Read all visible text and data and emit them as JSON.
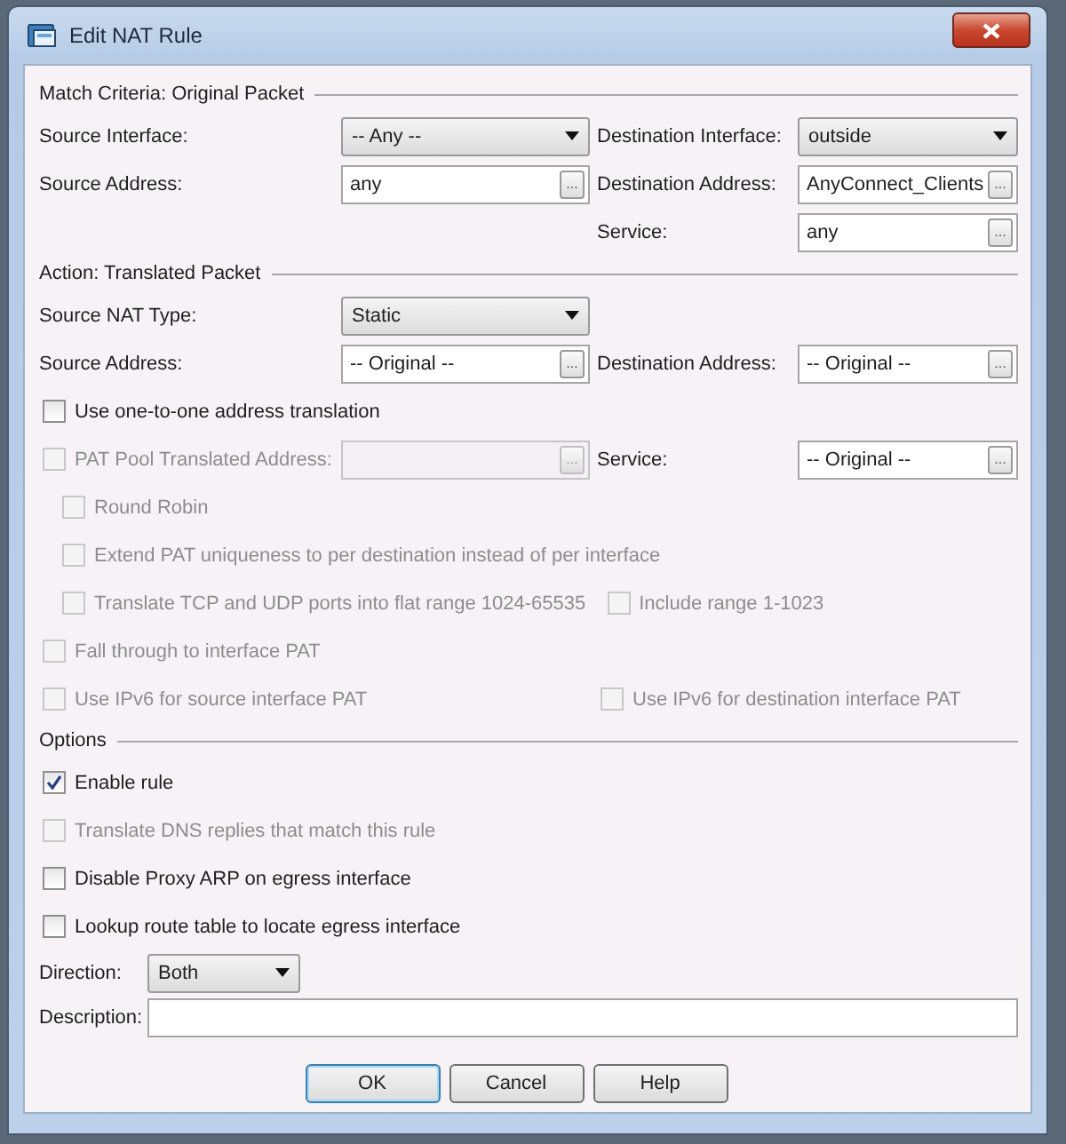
{
  "window": {
    "title": "Edit NAT Rule"
  },
  "sections": [
    {
      "title": "Match Criteria: Original Packet",
      "rows": [
        {
          "kind": "pair",
          "left": [
            {
              "kind": "label",
              "text": "Source Interface:"
            },
            {
              "kind": "dropdown",
              "value": "-- Any --"
            }
          ],
          "right": [
            {
              "kind": "label",
              "text": "Destination Interface:"
            },
            {
              "kind": "dropdown",
              "value": "outside"
            }
          ]
        },
        {
          "kind": "pair",
          "left": [
            {
              "kind": "label",
              "text": "Source Address:"
            },
            {
              "kind": "field",
              "value": "any",
              "button": "..."
            }
          ],
          "right": [
            {
              "kind": "label",
              "text": "Destination Address:"
            },
            {
              "kind": "field",
              "value": "AnyConnect_Clients",
              "button": "..."
            }
          ]
        },
        {
          "kind": "pair",
          "right": [
            {
              "kind": "label",
              "text": "Service:"
            },
            {
              "kind": "field",
              "value": "any",
              "button": "..."
            }
          ]
        }
      ]
    },
    {
      "title": "Action: Translated Packet",
      "rows": [
        {
          "kind": "pair",
          "left": [
            {
              "kind": "label",
              "text": "Source NAT Type:"
            },
            {
              "kind": "dropdown",
              "value": "Static"
            }
          ]
        },
        {
          "kind": "pair",
          "left": [
            {
              "kind": "label",
              "text": "Source Address:"
            },
            {
              "kind": "field",
              "value": "-- Original --",
              "button": "..."
            }
          ],
          "right": [
            {
              "kind": "label",
              "text": "Destination Address:"
            },
            {
              "kind": "field",
              "value": "-- Original --",
              "button": "..."
            }
          ]
        },
        {
          "kind": "pair",
          "left": [
            {
              "kind": "checkbox",
              "label": "Use one-to-one address translation",
              "checked": false,
              "disabled": false
            }
          ]
        },
        {
          "kind": "pair",
          "left": [
            {
              "kind": "checkbox",
              "label": "PAT Pool Translated Address:",
              "checked": false,
              "disabled": true
            },
            {
              "kind": "field",
              "button": "...",
              "disabled": true
            }
          ],
          "right": [
            {
              "kind": "label",
              "text": "Service:"
            },
            {
              "kind": "field",
              "value": "-- Original --",
              "button": "..."
            }
          ],
          "children": [
            {
              "kind": "pair",
              "left": [
                {
                  "kind": "checkbox",
                  "label": "Round Robin",
                  "checked": false,
                  "disabled": true
                }
              ]
            },
            {
              "kind": "pair",
              "left": [
                {
                  "kind": "checkbox",
                  "label": "Extend PAT uniqueness to per destination instead of per interface",
                  "checked": false,
                  "disabled": true
                }
              ]
            },
            {
              "kind": "pair",
              "left": [
                {
                  "kind": "checkbox",
                  "label": "Translate TCP and UDP ports into flat range 1024-65535",
                  "checked": false,
                  "disabled": true
                },
                {
                  "kind": "checkbox",
                  "label": "Include range 1-1023",
                  "checked": false,
                  "disabled": true
                }
              ]
            }
          ]
        },
        {
          "kind": "pair",
          "left": [
            {
              "kind": "checkbox",
              "label": "Fall through to interface PAT",
              "checked": false,
              "disabled": true
            }
          ]
        },
        {
          "kind": "pair",
          "left": [
            {
              "kind": "checkbox",
              "label": "Use IPv6 for source interface PAT",
              "checked": false,
              "disabled": true
            }
          ],
          "right": [
            {
              "kind": "checkbox",
              "label": "Use IPv6 for destination interface PAT",
              "checked": false,
              "disabled": true
            }
          ]
        }
      ]
    },
    {
      "title": "Options",
      "rows": [
        {
          "kind": "pair",
          "left": [
            {
              "kind": "checkbox",
              "label": "Enable rule",
              "checked": true,
              "disabled": false
            }
          ]
        },
        {
          "kind": "pair",
          "left": [
            {
              "kind": "checkbox",
              "label": "Translate DNS replies that match this rule",
              "checked": false,
              "disabled": true
            }
          ]
        },
        {
          "kind": "pair",
          "left": [
            {
              "kind": "checkbox",
              "label": "Disable Proxy ARP on egress interface",
              "checked": false,
              "disabled": false
            }
          ]
        },
        {
          "kind": "pair",
          "left": [
            {
              "kind": "checkbox",
              "label": "Lookup route table to locate egress interface",
              "checked": false,
              "disabled": false
            }
          ]
        },
        {
          "kind": "inline",
          "items": [
            {
              "kind": "label",
              "text": "Direction:"
            },
            {
              "kind": "dropdown",
              "value": "Both"
            }
          ]
        },
        {
          "kind": "inline",
          "items": [
            {
              "kind": "label",
              "text": "Description:"
            },
            {
              "kind": "field"
            }
          ]
        }
      ]
    }
  ],
  "buttons": [
    {
      "label": "OK",
      "default": true
    },
    {
      "label": "Cancel",
      "default": false
    },
    {
      "label": "Help",
      "default": false
    }
  ]
}
